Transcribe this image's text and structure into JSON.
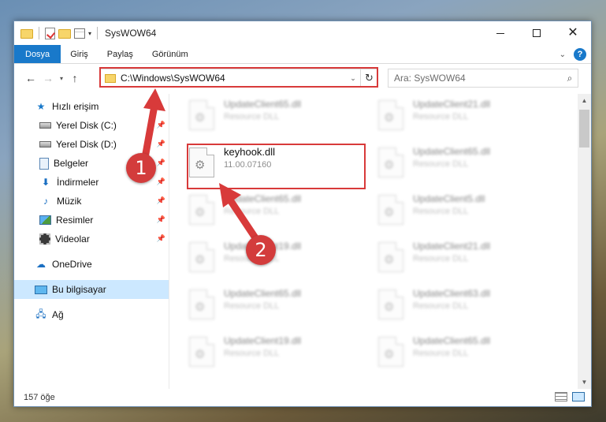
{
  "window": {
    "title": "SysWOW64",
    "buttons": {
      "minimize": "minimize",
      "maximize": "maximize",
      "close": "✕"
    }
  },
  "ribbon": {
    "tabs": [
      "Dosya",
      "Giriş",
      "Paylaş",
      "Görünüm"
    ],
    "help": "?"
  },
  "navigation": {
    "address": "C:\\Windows\\SysWOW64",
    "search_placeholder": "Ara: SysWOW64"
  },
  "sidebar": {
    "items": [
      {
        "label": "Hızlı erişim",
        "icon": "star-icon",
        "pinned": false
      },
      {
        "label": "Yerel Disk (C:)",
        "icon": "drive-icon",
        "pinned": true
      },
      {
        "label": "Yerel Disk (D:)",
        "icon": "drive-icon",
        "pinned": true
      },
      {
        "label": "Belgeler",
        "icon": "documents-icon",
        "pinned": true
      },
      {
        "label": "İndirmeler",
        "icon": "download-icon",
        "pinned": true
      },
      {
        "label": "Müzik",
        "icon": "music-icon",
        "pinned": true
      },
      {
        "label": "Resimler",
        "icon": "pictures-icon",
        "pinned": true
      },
      {
        "label": "Videolar",
        "icon": "videos-icon",
        "pinned": true
      },
      {
        "label": "OneDrive",
        "icon": "cloud-icon",
        "pinned": false
      },
      {
        "label": "Bu bilgisayar",
        "icon": "computer-icon",
        "pinned": false,
        "selected": true
      },
      {
        "label": "Ağ",
        "icon": "network-icon",
        "pinned": false
      }
    ]
  },
  "files": {
    "left": [
      {
        "name": "UpdateClient65.dll",
        "sub": "Resource DLL"
      },
      {
        "name": "keyhook.dll",
        "sub": "11.00.07160",
        "highlighted": true
      },
      {
        "name": "UpdateClient65.dll",
        "sub": "Resource DLL"
      },
      {
        "name": "UpdateClient19.dll",
        "sub": "Resource DLL"
      },
      {
        "name": "UpdateClient65.dll",
        "sub": "Resource DLL"
      },
      {
        "name": "UpdateClient19.dll",
        "sub": "Resource DLL"
      }
    ],
    "right": [
      {
        "name": "UpdateClient21.dll",
        "sub": "Resource DLL"
      },
      {
        "name": "UpdateClient65.dll",
        "sub": "Resource DLL"
      },
      {
        "name": "UpdateClient5.dll",
        "sub": "Resource DLL"
      },
      {
        "name": "UpdateClient21.dll",
        "sub": "Resource DLL"
      },
      {
        "name": "UpdateClient63.dll",
        "sub": "Resource DLL"
      },
      {
        "name": "UpdateClient65.dll",
        "sub": "Resource DLL"
      }
    ]
  },
  "status": {
    "count": "157 öğe"
  },
  "annotations": {
    "step1": "1",
    "step2": "2",
    "color": "#d83a3a"
  }
}
